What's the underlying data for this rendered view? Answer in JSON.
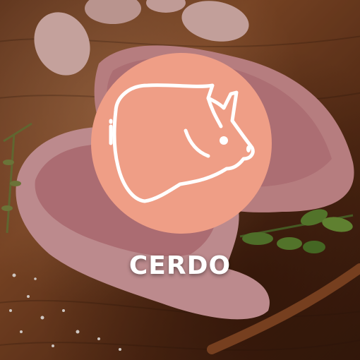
{
  "category": {
    "label": "CERDO",
    "icon": "pig-head-icon",
    "badge_color": "#ef9e86",
    "icon_stroke_color": "#ffffff",
    "label_color": "#ffffff"
  }
}
